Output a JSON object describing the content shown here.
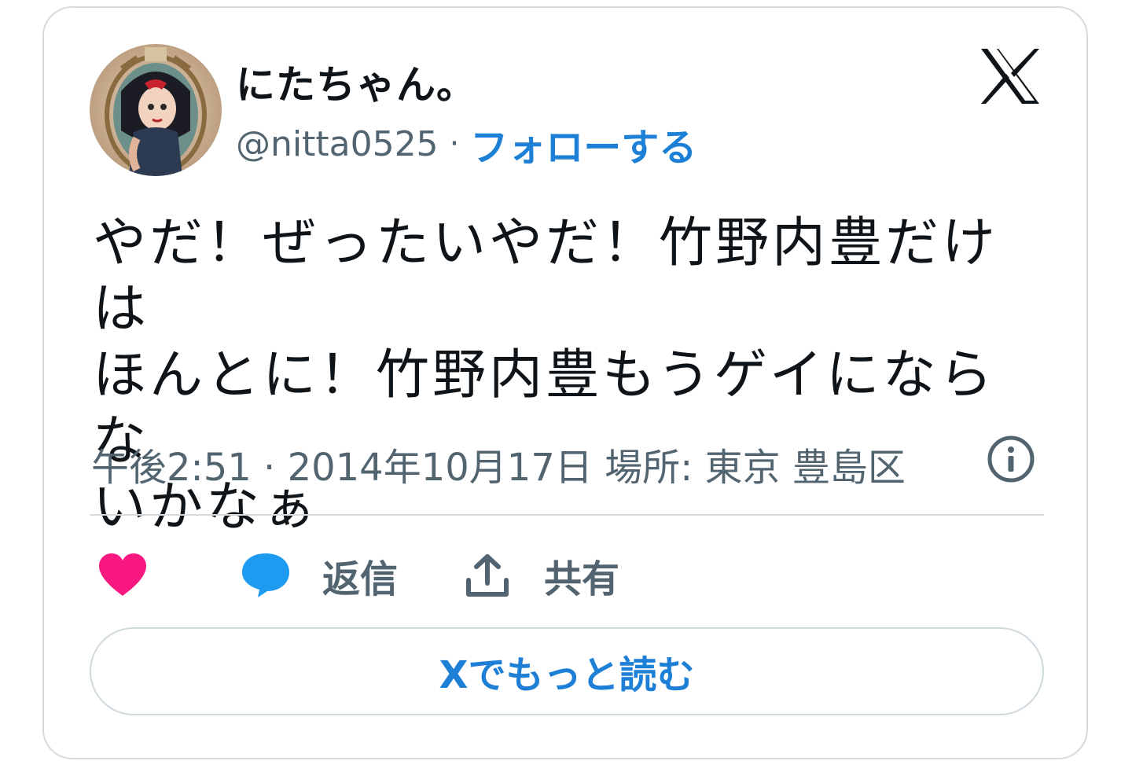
{
  "author": {
    "display_name": "にたちゃん。",
    "handle": "@nitta0525",
    "separator": "·",
    "follow_label": "フォローする"
  },
  "tweet": {
    "text": "やだ！ぜったいやだ！竹野内豊だけは\nほんとに！竹野内豊もうゲイにならな\nいかなぁ",
    "meta": "午後2:51 · 2014年10月17日 場所: 東京 豊島区"
  },
  "actions": {
    "reply_label": "返信",
    "share_label": "共有"
  },
  "read_more_label": "Xでもっと読む",
  "icons": {
    "logo": "x-logo-icon",
    "info": "info-icon",
    "like": "heart-icon",
    "reply": "speech-bubble-icon",
    "share": "share-upload-icon"
  },
  "colors": {
    "link": "#1d80d6",
    "heart": "#f91880",
    "reply_bubble": "#1d9bf0",
    "muted_text": "#536471",
    "border": "#d6dadd"
  }
}
